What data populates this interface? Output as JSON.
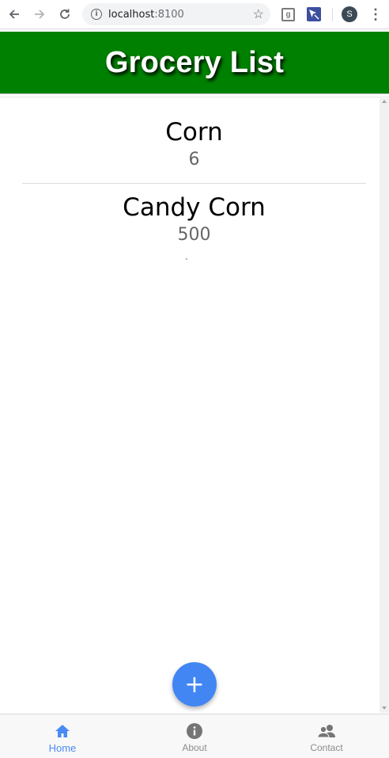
{
  "browser": {
    "url_host": "localhost",
    "url_port": ":8100",
    "avatar_letter": "S",
    "ext1_letter": "g"
  },
  "app": {
    "title": "Grocery List",
    "header_color": "#008000",
    "accent_color": "#4286f4"
  },
  "items": [
    {
      "name": "Corn",
      "quantity": "6"
    },
    {
      "name": "Candy Corn",
      "quantity": "500"
    }
  ],
  "stray_mark": "`",
  "fab": {
    "icon": "plus-icon",
    "label": "+"
  },
  "tabs": [
    {
      "label": "Home",
      "icon": "home-icon",
      "active": true
    },
    {
      "label": "About",
      "icon": "info-icon",
      "active": false
    },
    {
      "label": "Contact",
      "icon": "people-icon",
      "active": false
    }
  ]
}
